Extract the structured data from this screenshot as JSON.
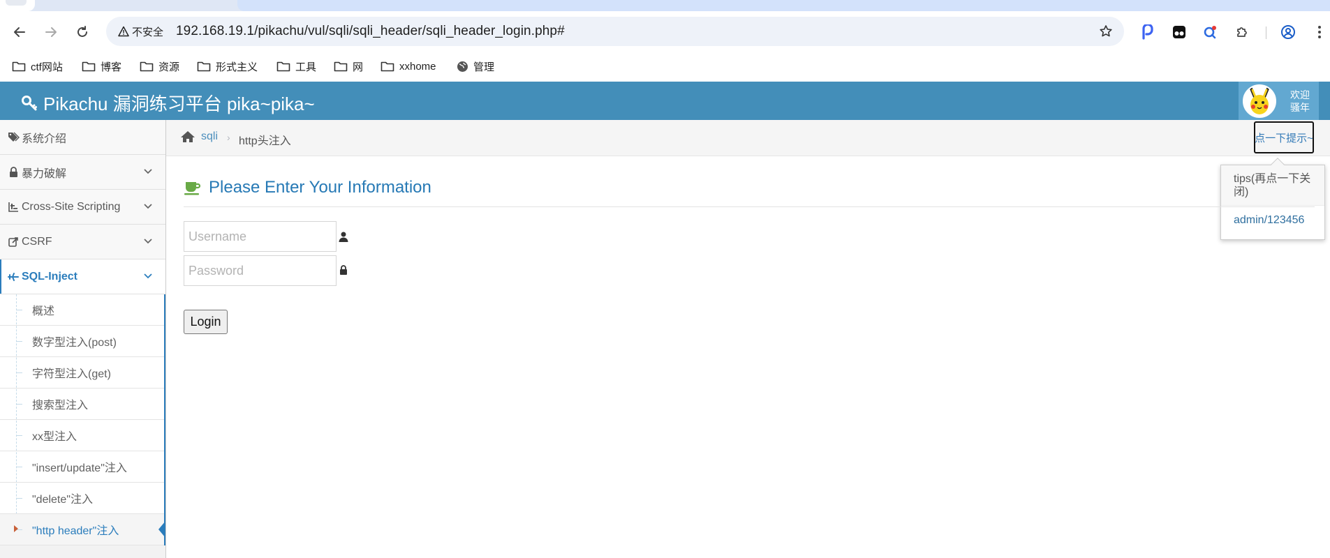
{
  "browser": {
    "security_label": "不安全",
    "url": "192.168.19.1/pikachu/vul/sqli/sqli_header/sqli_header_login.php#",
    "bookmarks": [
      {
        "label": "ctf网站",
        "icon": "folder-icon"
      },
      {
        "label": "博客",
        "icon": "folder-icon"
      },
      {
        "label": "资源",
        "icon": "folder-icon"
      },
      {
        "label": "形式主义",
        "icon": "folder-icon"
      },
      {
        "label": "工具",
        "icon": "folder-icon"
      },
      {
        "label": "网",
        "icon": "folder-icon"
      },
      {
        "label": "xxhome",
        "icon": "folder-icon"
      },
      {
        "label": "管理",
        "icon": "globe-icon"
      }
    ]
  },
  "header": {
    "brand": "Pikachu 漏洞练习平台 pika~pika~",
    "welcome_line1": "欢迎",
    "welcome_line2": "骚年",
    "bar_color": "#438eb9"
  },
  "sidebar": {
    "items": [
      {
        "label": "系统介绍",
        "icon": "tags-icon",
        "has_chevron": false
      },
      {
        "label": "暴力破解",
        "icon": "lock-icon",
        "has_chevron": true
      },
      {
        "label": "Cross-Site Scripting",
        "icon": "sliders-icon",
        "has_chevron": true
      },
      {
        "label": "CSRF",
        "icon": "share-icon",
        "has_chevron": true
      },
      {
        "label": "SQL-Inject",
        "icon": "plane-icon",
        "has_chevron": true
      }
    ],
    "sql_submenu": [
      "概述",
      "数字型注入(post)",
      "字符型注入(get)",
      "搜索型注入",
      "xx型注入",
      "\"insert/update\"注入",
      "\"delete\"注入",
      "\"http header\"注入"
    ]
  },
  "breadcrumb": {
    "home": "sqli",
    "current": "http头注入"
  },
  "hint": {
    "button": "点一下提示~",
    "title": "tips(再点一下关闭)",
    "body": "admin/123456"
  },
  "form": {
    "title": "Please Enter Your Information",
    "username_placeholder": "Username",
    "password_placeholder": "Password",
    "login_label": "Login"
  }
}
